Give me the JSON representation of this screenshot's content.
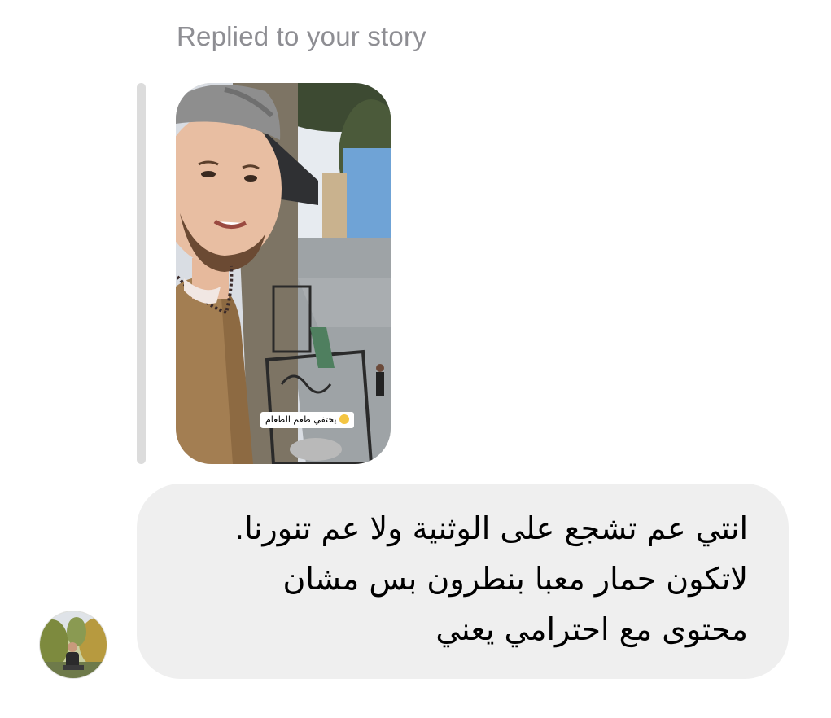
{
  "reply": {
    "label": "Replied to your story"
  },
  "story": {
    "caption": "يختفي طعم الطعام",
    "caption_emoji": "grinning-face-emoji"
  },
  "message": {
    "text": "انتي عم تشجع على الوثنية ولا عم تنورنا.\nلاتكون حمار معبا بنطرون بس مشان\nمحتوى مع احترامي يعني"
  },
  "sender": {
    "avatar_icon": "user-avatar"
  },
  "colors": {
    "label_gray": "#8e8e93",
    "bubble_bg": "#efefef",
    "quote_bar": "#dcdcdc"
  }
}
